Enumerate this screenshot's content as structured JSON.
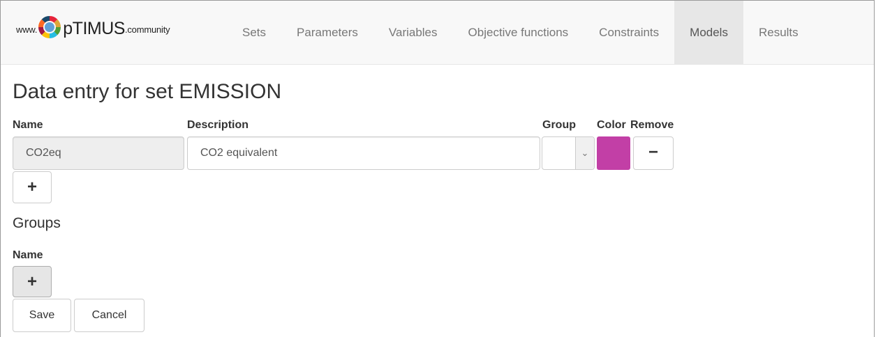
{
  "brand": {
    "prefix": "www.",
    "name": "pTIMUS",
    "suffix": ".community"
  },
  "nav": {
    "items": [
      {
        "label": "Sets"
      },
      {
        "label": "Parameters"
      },
      {
        "label": "Variables"
      },
      {
        "label": "Objective functions"
      },
      {
        "label": "Constraints"
      },
      {
        "label": "Models",
        "active": true
      },
      {
        "label": "Results"
      }
    ]
  },
  "page": {
    "title": "Data entry for set EMISSION"
  },
  "table": {
    "headers": {
      "name": "Name",
      "description": "Description",
      "group": "Group",
      "color": "Color",
      "remove": "Remove"
    },
    "row": {
      "name": "CO2eq",
      "description": "CO2 equivalent",
      "group": "",
      "color": "#c23fa6"
    }
  },
  "icons": {
    "add": "plus-icon",
    "remove": "minus-icon",
    "dropdown": "chevron-down-icon"
  },
  "groups": {
    "title": "Groups",
    "name_header": "Name"
  },
  "buttons": {
    "add_symbol": "+",
    "remove_symbol": "−",
    "save": "Save",
    "cancel": "Cancel"
  }
}
